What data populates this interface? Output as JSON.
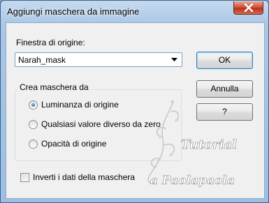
{
  "dialog": {
    "title": "Aggiungi maschera da immagine",
    "close_icon": "close-icon"
  },
  "source_window": {
    "label": "Finestra di origine:",
    "selected_value": "Narah_mask"
  },
  "buttons": {
    "ok": "OK",
    "cancel": "Annulla",
    "help": "?"
  },
  "create_mask": {
    "group_label": "Crea maschera da",
    "options": [
      {
        "label": "Luminanza di origine",
        "selected": true
      },
      {
        "label": "Qualsiasi valore diverso da zero",
        "selected": false
      },
      {
        "label": "Opacità di origine",
        "selected": false
      }
    ]
  },
  "invert": {
    "label": "Inverti i dati della maschera",
    "checked": false
  },
  "watermark": {
    "line1": "Tutorial",
    "line2": "a Paolapaola"
  },
  "colors": {
    "title_bar": "#9dbfe2",
    "close_button": "#c8432d",
    "default_button_border": "#3c7fb1"
  }
}
